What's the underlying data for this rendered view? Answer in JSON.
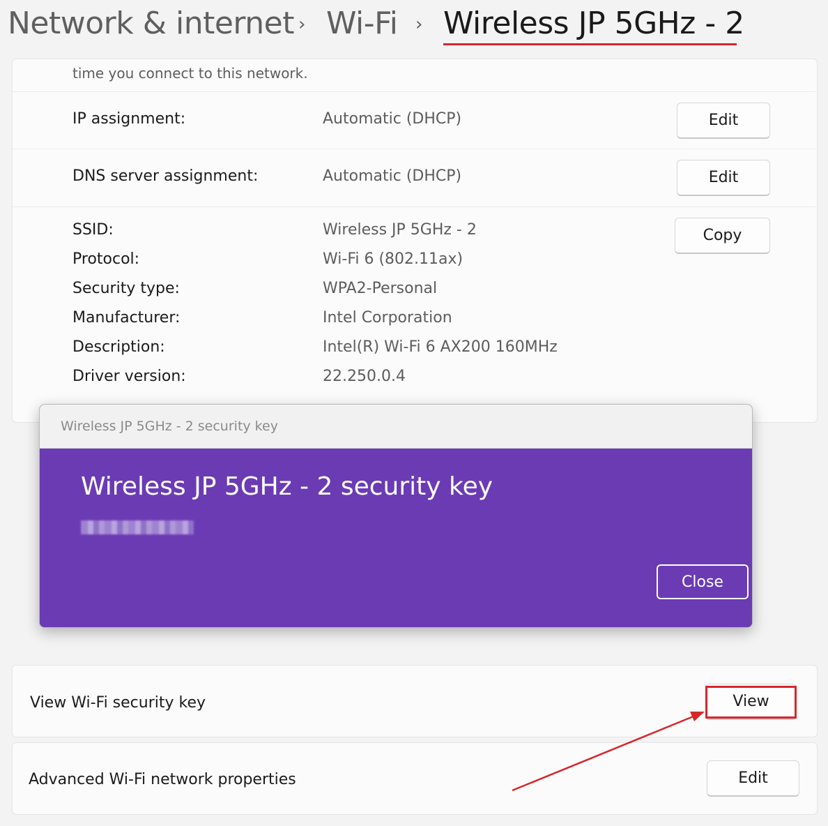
{
  "breadcrumb": {
    "items": [
      "Network & internet",
      "Wi-Fi",
      "Wireless JP 5GHz - 2"
    ],
    "separator": "›"
  },
  "top_text": "time you connect to this network.",
  "ip": {
    "label": "IP assignment:",
    "value": "Automatic (DHCP)",
    "button": "Edit"
  },
  "dns": {
    "label": "DNS server assignment:",
    "value": "Automatic (DHCP)",
    "button": "Edit"
  },
  "properties": {
    "copy_button": "Copy",
    "rows": [
      {
        "label": "SSID:",
        "value": "Wireless JP 5GHz - 2"
      },
      {
        "label": "Protocol:",
        "value": "Wi-Fi 6 (802.11ax)"
      },
      {
        "label": "Security type:",
        "value": "WPA2-Personal"
      },
      {
        "label": "Manufacturer:",
        "value": "Intel Corporation"
      },
      {
        "label": "Description:",
        "value": "Intel(R) Wi-Fi 6 AX200 160MHz"
      },
      {
        "label": "Driver version:",
        "value": "22.250.0.4"
      }
    ]
  },
  "dialog": {
    "window_title": "Wireless JP 5GHz - 2 security key",
    "heading": "Wireless JP 5GHz - 2 security key",
    "close_button": "Close"
  },
  "security_key_row": {
    "label": "View Wi-Fi security key",
    "button": "View"
  },
  "advanced_row": {
    "label": "Advanced Wi-Fi network properties",
    "button": "Edit"
  },
  "colors": {
    "annotation_red": "#d7262b",
    "dialog_purple": "#6b3bb4"
  }
}
